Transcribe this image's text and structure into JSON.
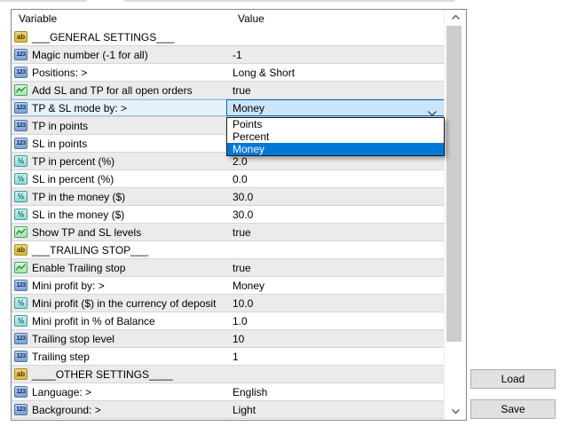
{
  "header": {
    "variable": "Variable",
    "value": "Value"
  },
  "icons": {
    "ab": "ab",
    "num": "123",
    "half": "½"
  },
  "rows": [
    {
      "icon": "text-icon",
      "label": "___GENERAL SETTINGS___",
      "value": ""
    },
    {
      "icon": "number-icon",
      "label": "Magic number (-1 for all)",
      "value": "-1"
    },
    {
      "icon": "number-icon",
      "label": "Positions: >",
      "value": "Long & Short"
    },
    {
      "icon": "chart-icon",
      "label": "Add SL and TP for all open orders",
      "value": "true"
    },
    {
      "icon": "number-icon",
      "label": "TP & SL mode by: >",
      "value": "Money"
    },
    {
      "icon": "number-icon",
      "label": "TP in points",
      "value": ""
    },
    {
      "icon": "number-icon",
      "label": "SL in points",
      "value": ""
    },
    {
      "icon": "decimal-icon",
      "label": "TP in percent (%)",
      "value": "2.0"
    },
    {
      "icon": "decimal-icon",
      "label": "SL in percent (%)",
      "value": "0.0"
    },
    {
      "icon": "decimal-icon",
      "label": "TP in the money ($)",
      "value": "30.0"
    },
    {
      "icon": "decimal-icon",
      "label": "SL in the money ($)",
      "value": "30.0"
    },
    {
      "icon": "chart-icon",
      "label": "Show TP and SL levels",
      "value": "true"
    },
    {
      "icon": "text-icon",
      "label": "___TRAILING STOP___",
      "value": ""
    },
    {
      "icon": "chart-icon",
      "label": "Enable Trailing stop",
      "value": "true"
    },
    {
      "icon": "number-icon",
      "label": "Mini profit by: >",
      "value": "Money"
    },
    {
      "icon": "decimal-icon",
      "label": "Mini profit ($) in the currency of deposit",
      "value": "10.0"
    },
    {
      "icon": "decimal-icon",
      "label": "Mini profit in % of Balance",
      "value": "1.0"
    },
    {
      "icon": "number-icon",
      "label": "Trailing stop level",
      "value": "10"
    },
    {
      "icon": "number-icon",
      "label": "Trailing step",
      "value": "1"
    },
    {
      "icon": "text-icon",
      "label": "____OTHER SETTINGS____",
      "value": ""
    },
    {
      "icon": "number-icon",
      "label": "Language: >",
      "value": "English"
    },
    {
      "icon": "number-icon",
      "label": "Background: >",
      "value": "Light"
    }
  ],
  "combobox": {
    "value": "Money"
  },
  "dropdown": {
    "items": [
      "Points",
      "Percent",
      "Money"
    ],
    "selected": "Money"
  },
  "buttons": {
    "load": "Load",
    "save": "Save"
  }
}
